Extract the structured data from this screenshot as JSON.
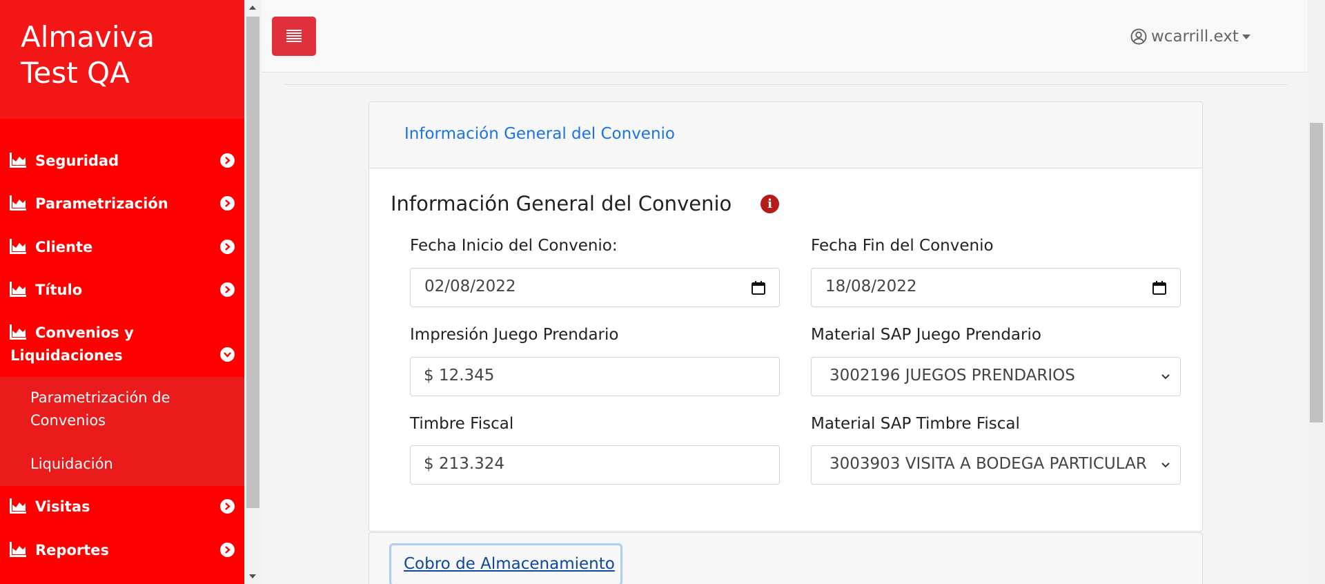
{
  "brand": {
    "line1": "Almaviva",
    "line2": "Test QA"
  },
  "sidebar": {
    "items": [
      {
        "label": "Seguridad",
        "icon": "chart-area-icon"
      },
      {
        "label": "Parametrización",
        "icon": "chart-area-icon"
      },
      {
        "label": "Cliente",
        "icon": "chart-area-icon"
      },
      {
        "label": "Título",
        "icon": "chart-area-icon"
      },
      {
        "label_line1": "Convenios y",
        "label_line2": "Liquidaciones",
        "icon": "chart-area-icon",
        "expanded": true
      },
      {
        "label": "Visitas",
        "icon": "chart-area-icon"
      },
      {
        "label": "Reportes",
        "icon": "chart-area-icon"
      }
    ],
    "submenu": [
      {
        "label_line1": "Parametrización de",
        "label_line2": "Convenios"
      },
      {
        "label": "Liquidación"
      }
    ]
  },
  "topbar": {
    "user": "wcarrill.ext"
  },
  "card": {
    "header_link": "Información General del Convenio",
    "title": "Información General del Convenio",
    "fields": {
      "fecha_inicio": {
        "label": "Fecha Inicio del Convenio:",
        "value": "02/08/2022"
      },
      "fecha_fin": {
        "label": "Fecha Fin del Convenio",
        "value": "18/08/2022"
      },
      "impresion": {
        "label": "Impresión Juego Prendario",
        "value": "$ 12.345"
      },
      "material_juego": {
        "label": "Material SAP Juego Prendario",
        "value": "3002196 JUEGOS PRENDARIOS"
      },
      "timbre": {
        "label": "Timbre Fiscal",
        "value": "$ 213.324"
      },
      "material_timbre": {
        "label": "Material SAP Timbre Fiscal",
        "value": "3003903 VISITA A BODEGA PARTICULAR"
      }
    }
  },
  "card2": {
    "button": "Cobro de Almacenamiento"
  },
  "colors": {
    "sidebar": "#ff0000",
    "brand": "#f21616",
    "menu_button": "#e0303b",
    "link": "#1a73e8",
    "info": "#b71c1c"
  }
}
